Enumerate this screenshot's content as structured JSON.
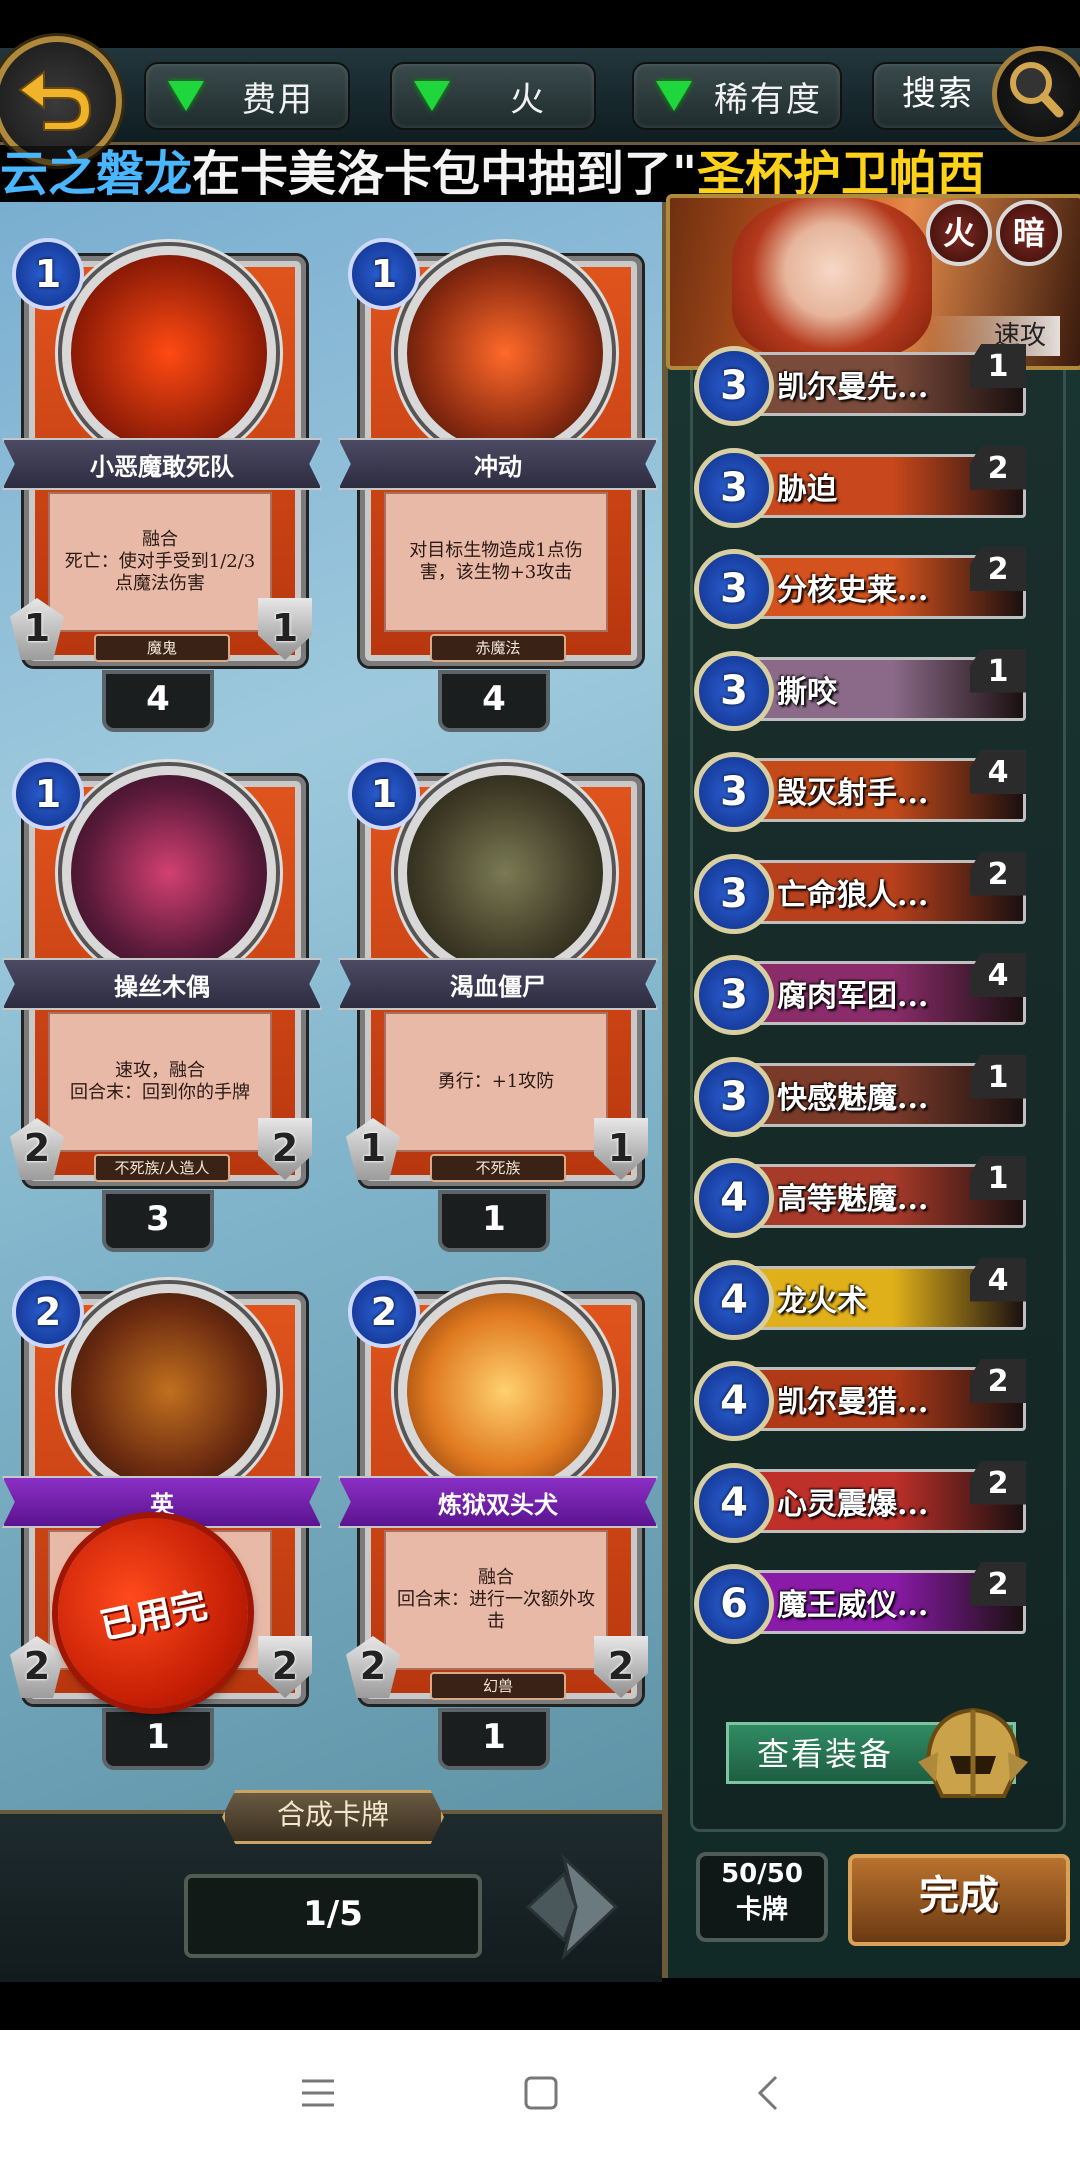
{
  "filters": [
    {
      "label": "费用"
    },
    {
      "label": "火"
    },
    {
      "label": "稀有度"
    }
  ],
  "search_label": "搜索",
  "marquee": {
    "part1": "云之磐龙",
    "part2": "在卡美洛卡包中抽到了\"",
    "part3": "圣杯护卫帕西"
  },
  "cards": [
    {
      "cost": "1",
      "name": "小恶魔敢死队",
      "text": "融合\n死亡：使对手受到1/2/3点魔法伤害",
      "tribe": "魔鬼",
      "atk": "1",
      "hp": "1",
      "count": "4",
      "banner": "normal"
    },
    {
      "cost": "1",
      "name": "冲动",
      "text": "对目标生物造成1点伤害，该生物+3攻击",
      "tribe": "赤魔法",
      "atk": "",
      "hp": "",
      "count": "4",
      "banner": "normal"
    },
    {
      "cost": "1",
      "name": "操丝木偶",
      "text": "速攻，融合\n回合末：回到你的手牌",
      "tribe": "不死族/人造人",
      "atk": "2",
      "hp": "2",
      "count": "3",
      "banner": "normal"
    },
    {
      "cost": "1",
      "name": "渴血僵尸",
      "text": "勇行：+1攻防",
      "tribe": "不死族",
      "atk": "1",
      "hp": "1",
      "count": "1",
      "banner": "normal"
    },
    {
      "cost": "2",
      "name": "英",
      "text": "",
      "tribe": "",
      "atk": "2",
      "hp": "2",
      "count": "1",
      "banner": "epic"
    },
    {
      "cost": "2",
      "name": "炼狱双头犬",
      "text": "融合\n回合末：进行一次额外攻击",
      "tribe": "幻兽",
      "atk": "2",
      "hp": "2",
      "count": "1",
      "banner": "epic"
    }
  ],
  "used_stamp": "已用完",
  "craft_button": "合成卡牌",
  "page_indicator": "1/5",
  "hero": {
    "badge1": "火",
    "badge2": "暗",
    "tag": "速攻"
  },
  "deck": [
    {
      "mana": "3",
      "name": "凯尔曼先...",
      "qty": "1",
      "color": "#7a4a3a"
    },
    {
      "mana": "3",
      "name": "胁迫",
      "qty": "2",
      "color": "#c8471c"
    },
    {
      "mana": "3",
      "name": "分核史莱...",
      "qty": "2",
      "color": "#d4521e"
    },
    {
      "mana": "3",
      "name": "撕咬",
      "qty": "1",
      "color": "#8a6a88"
    },
    {
      "mana": "3",
      "name": "毁灭射手...",
      "qty": "4",
      "color": "#c44a1a"
    },
    {
      "mana": "3",
      "name": "亡命狼人...",
      "qty": "2",
      "color": "#b8401c"
    },
    {
      "mana": "3",
      "name": "腐肉军团...",
      "qty": "4",
      "color": "#8a2c6a"
    },
    {
      "mana": "3",
      "name": "快感魅魔...",
      "qty": "1",
      "color": "#7a3a2a"
    },
    {
      "mana": "4",
      "name": "高等魅魔...",
      "qty": "1",
      "color": "#a83a2a"
    },
    {
      "mana": "4",
      "name": "龙火术",
      "qty": "4",
      "color": "#e0b01a"
    },
    {
      "mana": "4",
      "name": "凯尔曼猎...",
      "qty": "2",
      "color": "#b03a18"
    },
    {
      "mana": "4",
      "name": "心灵震爆...",
      "qty": "2",
      "color": "#c0302a"
    },
    {
      "mana": "6",
      "name": "魔王威仪...",
      "qty": "2",
      "color": "#8a1aa8"
    }
  ],
  "view_equipment": "查看装备",
  "deck_count": {
    "value": "50/50",
    "label": "卡牌"
  },
  "done_button": "完成",
  "colors": {
    "accent_gold": "#b08a3c",
    "mana_blue": "#2d63d8",
    "card_red": "#d84a1a"
  }
}
